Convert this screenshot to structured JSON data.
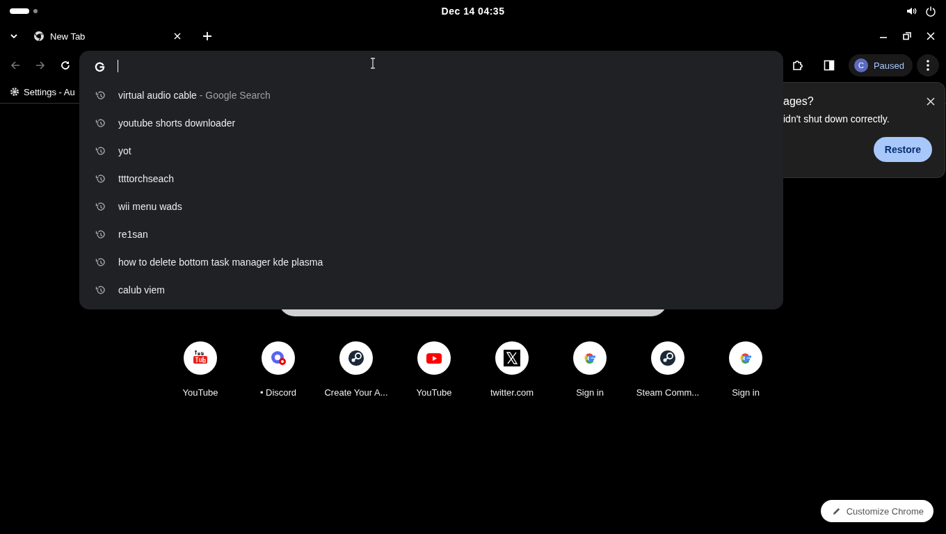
{
  "system_bar": {
    "clock": "Dec 14  04:35"
  },
  "tabs": [
    {
      "title": "New Tab",
      "selected": true
    }
  ],
  "profile": {
    "initial": "C",
    "label": "Paused"
  },
  "bookmarks": [
    {
      "label": "Settings - Au"
    }
  ],
  "omnibox": {
    "suggestions": [
      {
        "text": "virtual audio cable",
        "detail": "- Google Search"
      },
      {
        "text": "youtube shorts downloader"
      },
      {
        "text": "yot"
      },
      {
        "text": "ttttorchseach"
      },
      {
        "text": "wii menu wads"
      },
      {
        "text": "re1san"
      },
      {
        "text": "how to delete bottom task manager kde plasma"
      },
      {
        "text": "calub viem"
      }
    ]
  },
  "restore_bubble": {
    "title": "ages?",
    "message": "idn't shut down correctly.",
    "button": "Restore"
  },
  "shortcuts": [
    {
      "label": "YouTube",
      "kind": "tube"
    },
    {
      "label": "• Discord",
      "kind": "chat"
    },
    {
      "label": "Create Your A...",
      "kind": "steam"
    },
    {
      "label": "YouTube",
      "kind": "play"
    },
    {
      "label": "twitter.com",
      "kind": "x"
    },
    {
      "label": "Sign in",
      "kind": "g"
    },
    {
      "label": "Steam Comm...",
      "kind": "steam"
    },
    {
      "label": "Sign in",
      "kind": "g"
    }
  ],
  "customize_button": "Customize Chrome"
}
